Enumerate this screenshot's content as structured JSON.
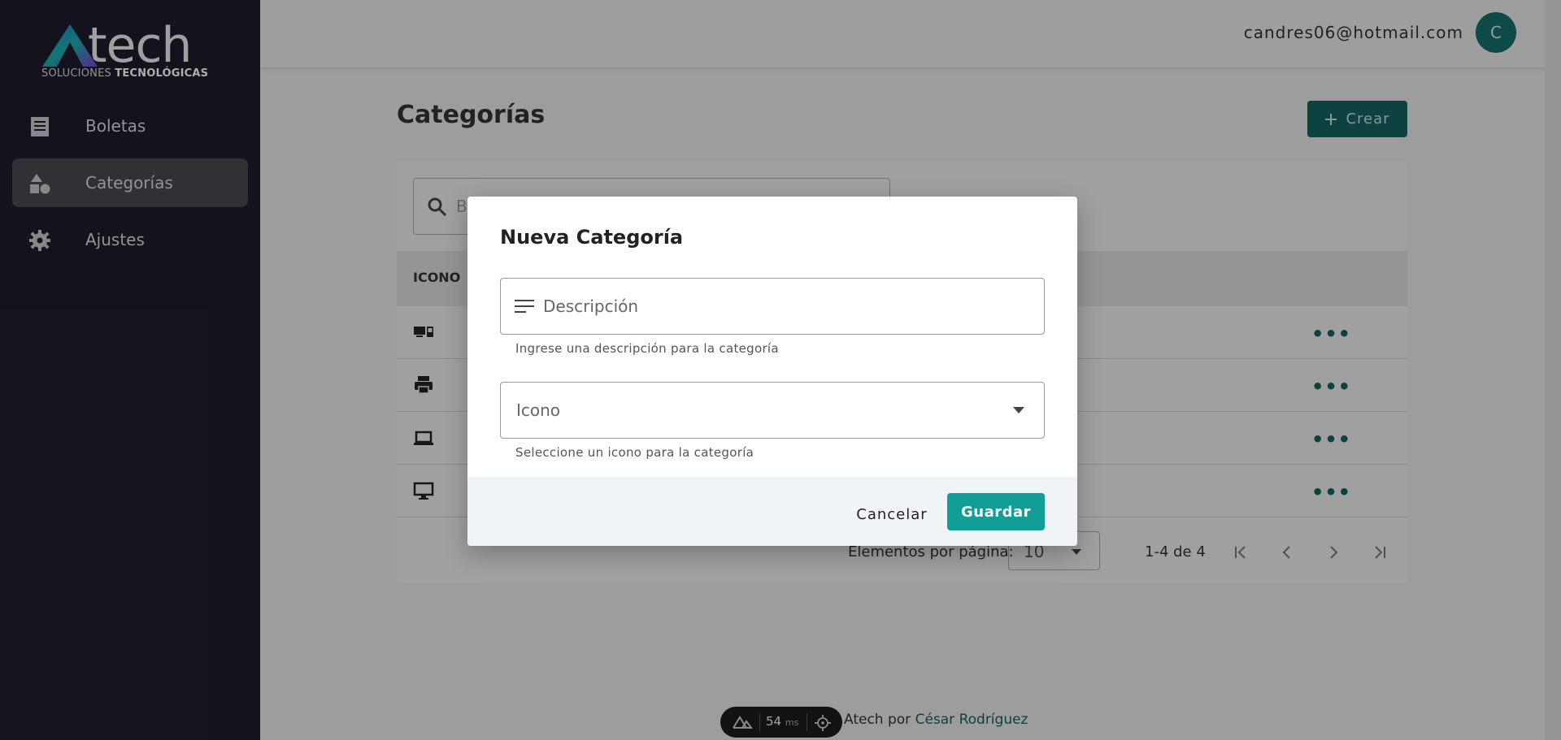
{
  "brand": {
    "name": "tech",
    "tagline_light": "SOLUCIONES",
    "tagline_bold": "TECNOLÓGICAS"
  },
  "sidebar": {
    "items": [
      {
        "label": "Boletas",
        "icon": "receipt-icon",
        "active": false
      },
      {
        "label": "Categorías",
        "icon": "shapes-icon",
        "active": true
      },
      {
        "label": "Ajustes",
        "icon": "gear-icon",
        "active": false
      }
    ]
  },
  "header": {
    "user_email": "candres06@hotmail.com",
    "avatar_initial": "C"
  },
  "page": {
    "title": "Categorías",
    "create_label": "Crear",
    "search_placeholder": "B"
  },
  "table": {
    "columns": [
      "ICONO"
    ],
    "rows": [
      {
        "icon": "devices-icon",
        "actions": "•••"
      },
      {
        "icon": "printer-icon",
        "actions": "•••"
      },
      {
        "icon": "laptop-icon",
        "actions": "•••"
      },
      {
        "icon": "desktop-icon",
        "actions": "•••"
      }
    ]
  },
  "pagination": {
    "per_page_label": "Elementos por página:",
    "per_page_value": "10",
    "range_label": "1-4 de 4"
  },
  "footer": {
    "text": "Atech por",
    "author": "César Rodríguez"
  },
  "devtool": {
    "ms_value": "54",
    "ms_unit": "ms"
  },
  "dialog": {
    "title": "Nueva Categoría",
    "description_placeholder": "Descripción",
    "description_hint": "Ingrese una descripción para la categoría",
    "icon_placeholder": "Icono",
    "icon_hint": "Seleccione un icono para la categoría",
    "cancel_label": "Cancelar",
    "save_label": "Guardar"
  },
  "colors": {
    "sidebar_bg": "#1e1d2b",
    "accent": "#119e97",
    "action": "#11625e"
  }
}
